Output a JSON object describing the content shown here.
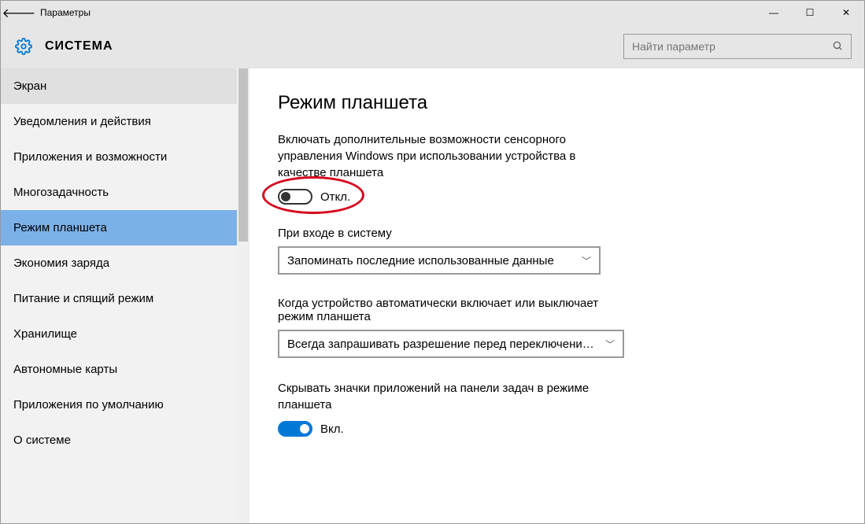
{
  "window": {
    "title": "Параметры"
  },
  "header": {
    "section": "СИСТЕМА",
    "search_placeholder": "Найти параметр"
  },
  "sidebar": {
    "items": [
      {
        "label": "Экран"
      },
      {
        "label": "Уведомления и действия"
      },
      {
        "label": "Приложения и возможности"
      },
      {
        "label": "Многозадачность"
      },
      {
        "label": "Режим планшета"
      },
      {
        "label": "Экономия заряда"
      },
      {
        "label": "Питание и спящий режим"
      },
      {
        "label": "Хранилище"
      },
      {
        "label": "Автономные карты"
      },
      {
        "label": "Приложения по умолчанию"
      },
      {
        "label": "О системе"
      }
    ],
    "selected_index": 4
  },
  "main": {
    "title": "Режим планшета",
    "tablet_toggle": {
      "description": "Включать дополнительные возможности сенсорного управления Windows при использовании устройства в качестве планшета",
      "state": "off",
      "state_label": "Откл."
    },
    "signin": {
      "label": "При входе в систему",
      "value": "Запоминать последние использованные данные"
    },
    "auto_switch": {
      "label": "Когда устройство автоматически включает или выключает режим планшета",
      "value": "Всегда запрашивать разрешение перед переключением..."
    },
    "hide_icons": {
      "description": "Скрывать значки приложений на панели задач в режиме планшета",
      "state": "on",
      "state_label": "Вкл."
    }
  }
}
